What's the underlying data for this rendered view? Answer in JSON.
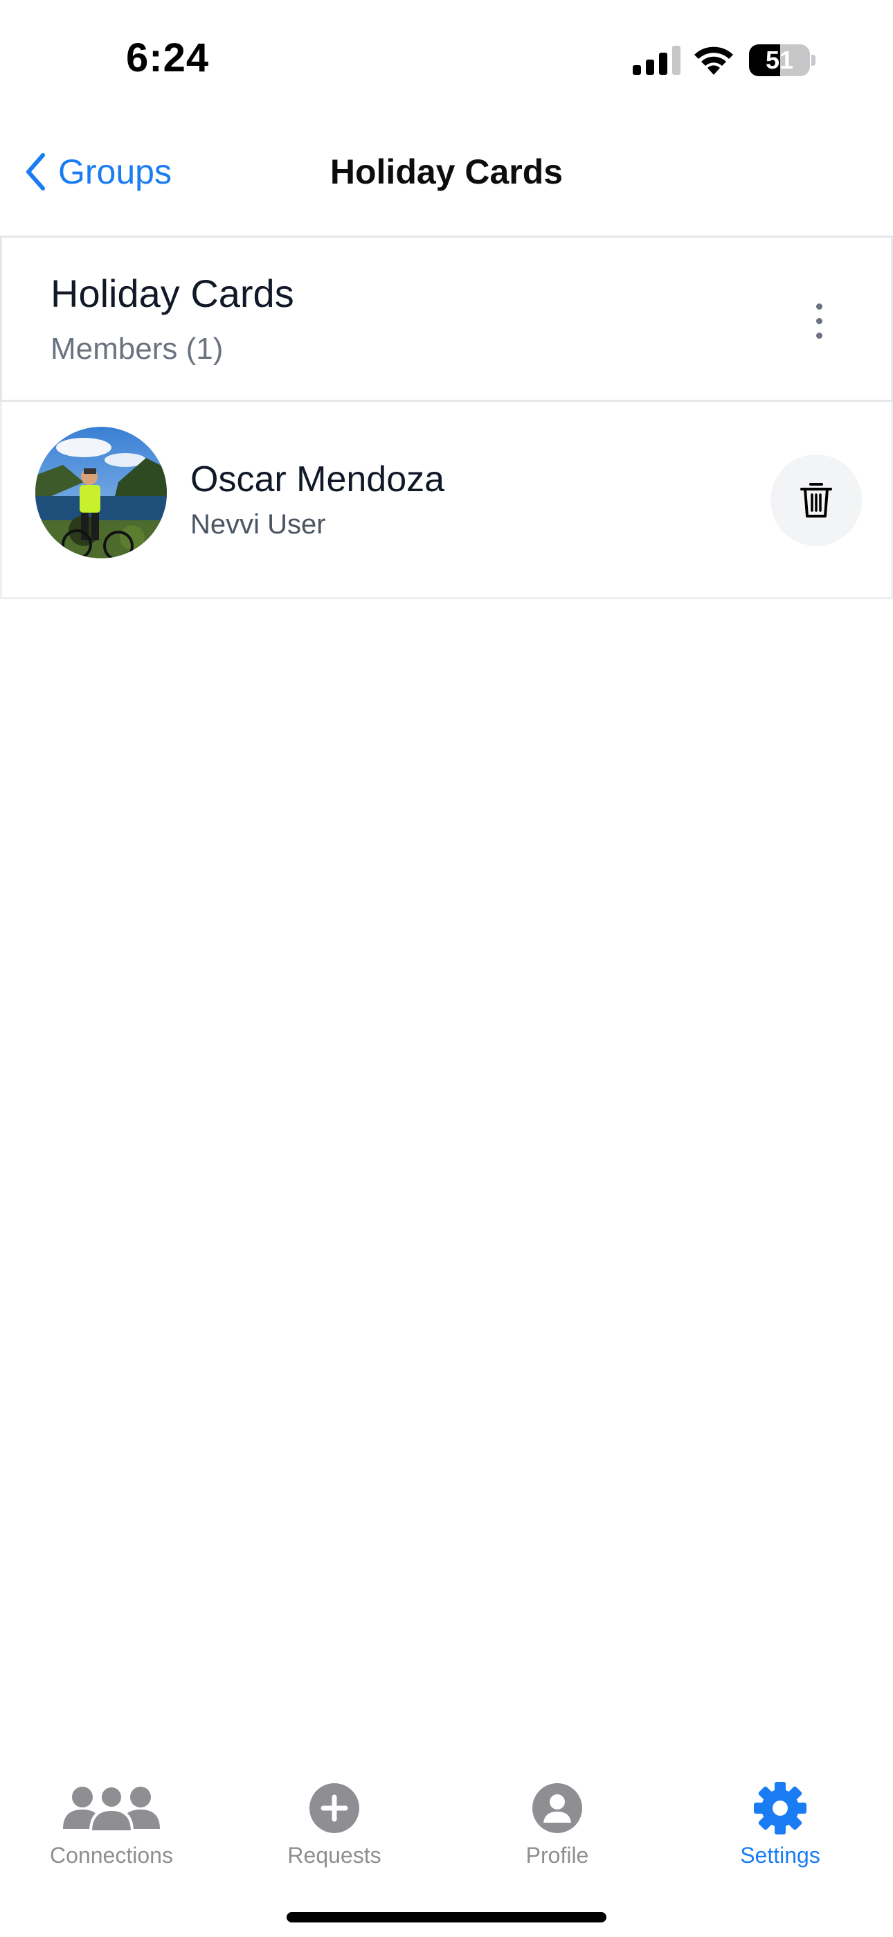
{
  "status_bar": {
    "time": "6:24",
    "battery_level": "51",
    "battery_fraction": 0.51
  },
  "nav": {
    "back_label": "Groups",
    "title": "Holiday Cards"
  },
  "group": {
    "title": "Holiday Cards",
    "members_label": "Members (1)"
  },
  "members": [
    {
      "name": "Oscar Mendoza",
      "role": "Nevvi User"
    }
  ],
  "tabs": [
    {
      "label": "Connections",
      "icon": "people-icon",
      "active": false
    },
    {
      "label": "Requests",
      "icon": "plus-circle-icon",
      "active": false
    },
    {
      "label": "Profile",
      "icon": "person-circle-icon",
      "active": false
    },
    {
      "label": "Settings",
      "icon": "gear-icon",
      "active": true
    }
  ],
  "colors": {
    "accent": "#1a7cf3",
    "inactive_tab": "#8e8e93",
    "text_primary": "#111827",
    "text_secondary": "#6b7280"
  }
}
